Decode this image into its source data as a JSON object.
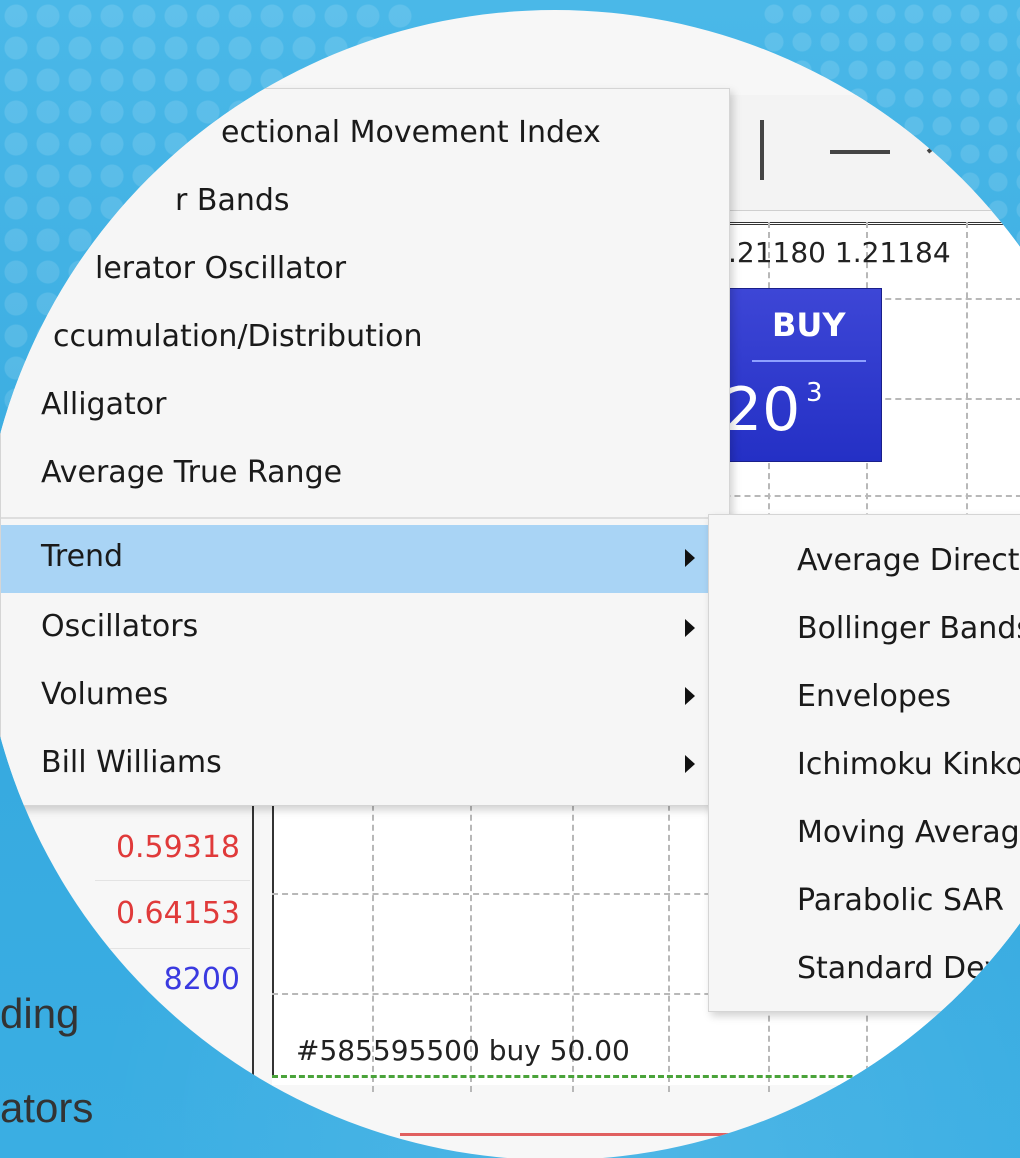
{
  "main_menu": {
    "top_items": [
      {
        "label": "ectional Movement Index"
      },
      {
        "label": "r Bands"
      },
      {
        "label": "lerator Oscillator"
      },
      {
        "label": "ccumulation/Distribution"
      },
      {
        "label": "Alligator"
      },
      {
        "label": "Average True Range"
      }
    ],
    "submenus": [
      {
        "label": "Trend",
        "selected": true
      },
      {
        "label": "Oscillators"
      },
      {
        "label": "Volumes"
      },
      {
        "label": "Bill Williams"
      }
    ]
  },
  "trend_submenu": {
    "items": [
      {
        "label": "Average Directi"
      },
      {
        "label": "Bollinger Bands"
      },
      {
        "label": "Envelopes"
      },
      {
        "label": "Ichimoku Kinko"
      },
      {
        "label": "Moving Average"
      },
      {
        "label": "Parabolic SAR"
      },
      {
        "label": "Standard Devia"
      }
    ]
  },
  "quote": {
    "bid_ask": ".21180 1.21184",
    "buy_label": "BUY",
    "buy_price_big": "20",
    "buy_price_sup": "3"
  },
  "left_values": [
    {
      "value": "0.59318",
      "color": "#e03a3a"
    },
    {
      "value": "0.64153",
      "color": "#e03a3a"
    },
    {
      "value": "8200",
      "color": "#3a3ae0"
    }
  ],
  "order_label": "#585595500 buy 50.00",
  "background_text": [
    "ding",
    "ators"
  ],
  "colors": {
    "menu_highlight": "#a9d4f5",
    "buy_button": "#2f3bd0",
    "background_blue": "#3fb4e6"
  }
}
